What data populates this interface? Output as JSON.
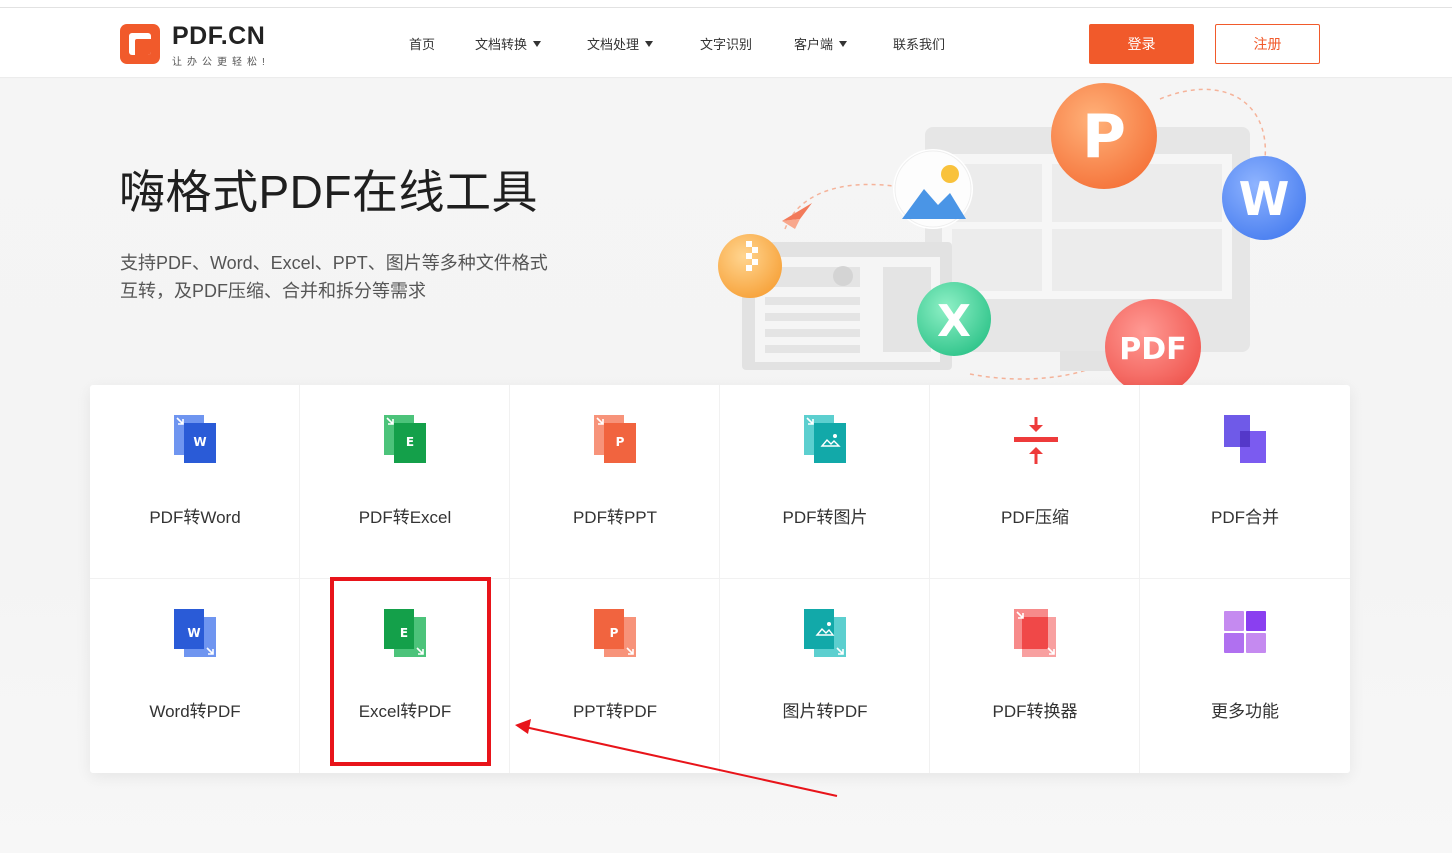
{
  "header": {
    "logo_text": "PDF.CN",
    "logo_sub": "让办公更轻松!",
    "nav": [
      {
        "label": "首页",
        "dropdown": false
      },
      {
        "label": "文档转换",
        "dropdown": true
      },
      {
        "label": "文档处理",
        "dropdown": true
      },
      {
        "label": "文字识别",
        "dropdown": false
      },
      {
        "label": "客户端",
        "dropdown": true
      },
      {
        "label": "联系我们",
        "dropdown": false
      }
    ],
    "login_label": "登录",
    "register_label": "注册"
  },
  "hero": {
    "title": "嗨格式PDF在线工具",
    "desc_line1": "支持PDF、Word、Excel、PPT、图片等多种文件格式",
    "desc_line2": "互转，及PDF压缩、合并和拆分等需求",
    "badges": {
      "p": "P",
      "w": "W",
      "x": "X",
      "pdf": "PDF"
    }
  },
  "tools": [
    {
      "label": "PDF转Word",
      "icon": "pdf-to-word-icon",
      "letter": "W"
    },
    {
      "label": "PDF转Excel",
      "icon": "pdf-to-excel-icon",
      "letter": "E"
    },
    {
      "label": "PDF转PPT",
      "icon": "pdf-to-ppt-icon",
      "letter": "P"
    },
    {
      "label": "PDF转图片",
      "icon": "pdf-to-image-icon",
      "letter": ""
    },
    {
      "label": "PDF压缩",
      "icon": "compress-icon",
      "letter": ""
    },
    {
      "label": "PDF合并",
      "icon": "merge-icon",
      "letter": ""
    },
    {
      "label": "Word转PDF",
      "icon": "word-to-pdf-icon",
      "letter": "W"
    },
    {
      "label": "Excel转PDF",
      "icon": "excel-to-pdf-icon",
      "letter": "E"
    },
    {
      "label": "PPT转PDF",
      "icon": "ppt-to-pdf-icon",
      "letter": "P"
    },
    {
      "label": "图片转PDF",
      "icon": "image-to-pdf-icon",
      "letter": ""
    },
    {
      "label": "PDF转换器",
      "icon": "converter-icon",
      "letter": ""
    },
    {
      "label": "更多功能",
      "icon": "more-features-icon",
      "letter": ""
    }
  ],
  "colors": {
    "accent": "#f15a2b",
    "word": "#2a5bd7",
    "excel": "#14a04a",
    "ppt": "#f1643f",
    "image": "#12a9a9",
    "compress": "#ee3b3b",
    "merge": "#7052e8",
    "converter": "#f04848",
    "more": "#a35ce6",
    "highlight": "#e8141a"
  }
}
